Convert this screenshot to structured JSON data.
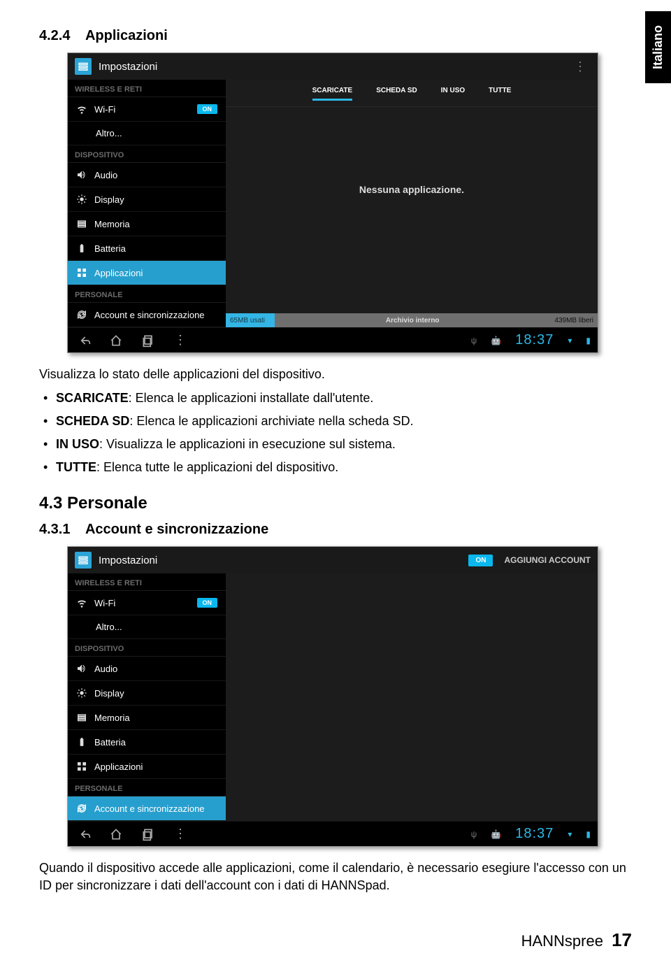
{
  "side_tab": "Italiano",
  "section_424": {
    "number": "4.2.4",
    "title": "Applicazioni"
  },
  "screenshot1": {
    "topbar_title": "Impostazioni",
    "sidebar": {
      "group1": "WIRELESS E RETI",
      "wifi": "Wi-Fi",
      "wifi_toggle": "ON",
      "altro": "Altro...",
      "group2": "DISPOSITIVO",
      "audio": "Audio",
      "display": "Display",
      "memoria": "Memoria",
      "batteria": "Batteria",
      "applicazioni": "Applicazioni",
      "group3": "PERSONALE",
      "account": "Account e sincronizzazione"
    },
    "tabs": {
      "scaricate": "SCARICATE",
      "scheda_sd": "SCHEDA SD",
      "in_uso": "IN USO",
      "tutte": "TUTTE"
    },
    "empty_msg": "Nessuna applicazione.",
    "storage": {
      "used": "65MB usati",
      "label": "Archivio interno",
      "free": "439MB liberi"
    },
    "clock": "18:37"
  },
  "body_para1": "Visualizza lo stato delle applicazioni del dispositivo.",
  "bullets": {
    "b1_strong": "SCARICATE",
    "b1_text": ": Elenca le applicazioni installate dall'utente.",
    "b2_strong": "SCHEDA SD",
    "b2_text": ": Elenca le applicazioni archiviate nella scheda SD.",
    "b3_strong": "IN USO",
    "b3_text": ": Visualizza le applicazioni in esecuzione sul sistema.",
    "b4_strong": "TUTTE",
    "b4_text": ": Elenca tutte le applicazioni del dispositivo."
  },
  "section_43": {
    "heading": "4.3  Personale"
  },
  "section_431": {
    "number": "4.3.1",
    "title": "Account e sincronizzazione"
  },
  "screenshot2": {
    "topbar_title": "Impostazioni",
    "topbar_toggle": "ON",
    "topbar_acct": "AGGIUNGI ACCOUNT",
    "sidebar": {
      "group1": "WIRELESS E RETI",
      "wifi": "Wi-Fi",
      "wifi_toggle": "ON",
      "altro": "Altro...",
      "group2": "DISPOSITIVO",
      "audio": "Audio",
      "display": "Display",
      "memoria": "Memoria",
      "batteria": "Batteria",
      "applicazioni": "Applicazioni",
      "group3": "PERSONALE",
      "account": "Account e sincronizzazione"
    },
    "clock": "18:37"
  },
  "body_para2": "Quando il dispositivo accede alle applicazioni, come il calendario, è necessario esegiure l'accesso con un ID per sincronizzare i dati dell'account con i dati di HANNSpad.",
  "footer": {
    "brand1": "HANN",
    "brand2": "spree",
    "page": "17"
  }
}
